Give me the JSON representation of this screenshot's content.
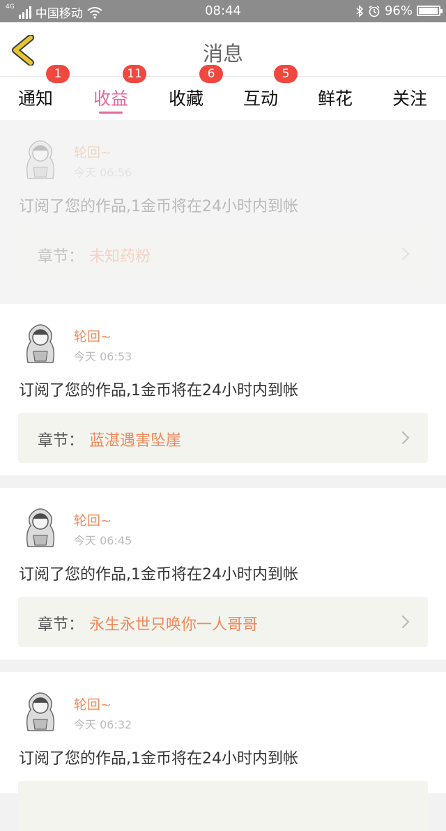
{
  "status_bar": {
    "network": "4G",
    "carrier": "中国移动",
    "time": "08:44",
    "battery_percent": "96%",
    "battery_level": 0.96
  },
  "header": {
    "title": "消息",
    "back_icon": "chevron-left-icon",
    "back_icon_color": "#e6c531"
  },
  "tabs": [
    {
      "label": "通知",
      "badge": "1"
    },
    {
      "label": "收益",
      "badge": "11"
    },
    {
      "label": "收藏",
      "badge": "6"
    },
    {
      "label": "互动",
      "badge": "5"
    },
    {
      "label": "鲜花",
      "badge": ""
    },
    {
      "label": "关注",
      "badge": ""
    }
  ],
  "active_tab": "收益",
  "colors": {
    "accent": "#e5679a",
    "badge": "#f0473e",
    "username": "#f0895a",
    "chapter_title": "#f0895a"
  },
  "messages": [
    {
      "user": "轮回~",
      "time": "今天 06:56",
      "text": "订阅了您的作品,1金币将在24小时内到帐",
      "chapter_label": "章节：",
      "chapter_title": "未知药粉"
    },
    {
      "user": "轮回~",
      "time": "今天 06:53",
      "text": "订阅了您的作品,1金币将在24小时内到帐",
      "chapter_label": "章节：",
      "chapter_title": "蓝湛遇害坠崖"
    },
    {
      "user": "轮回~",
      "time": "今天 06:45",
      "text": "订阅了您的作品,1金币将在24小时内到帐",
      "chapter_label": "章节：",
      "chapter_title": "永生永世只唤你一人哥哥"
    },
    {
      "user": "轮回~",
      "time": "今天 06:32",
      "text": "订阅了您的作品,1金币将在24小时内到帐",
      "chapter_label": "",
      "chapter_title": ""
    }
  ]
}
